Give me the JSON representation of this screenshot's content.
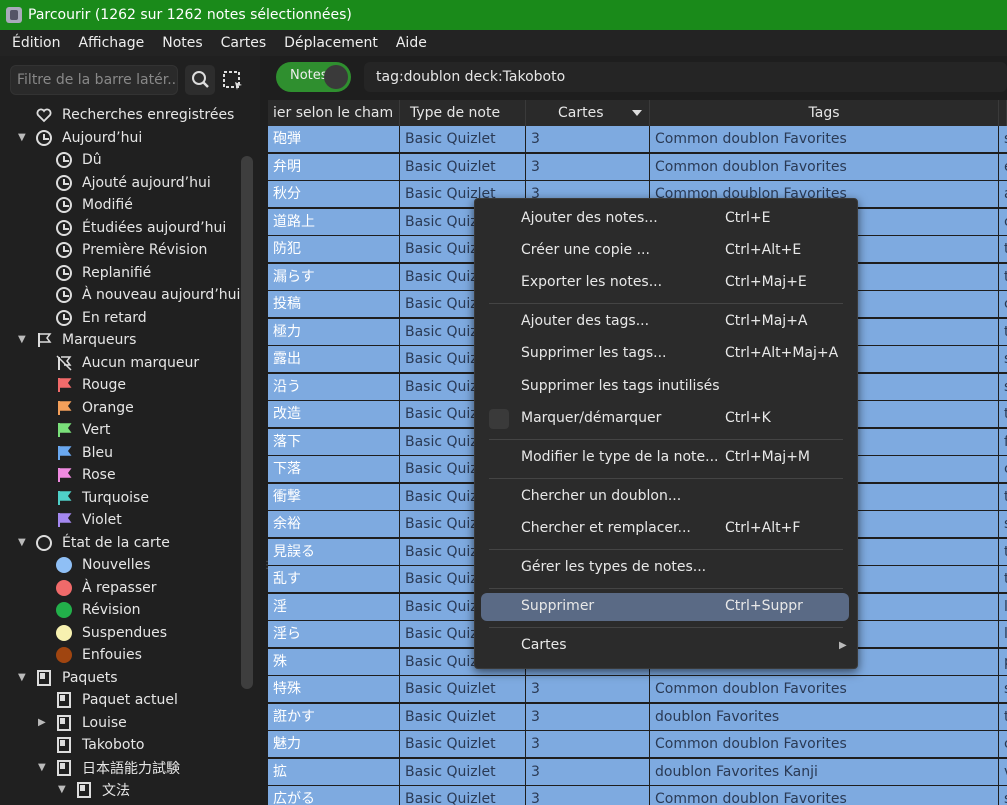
{
  "window": {
    "title": "Parcourir (1262 sur 1262 notes sélectionnées)"
  },
  "menubar": [
    "Édition",
    "Affichage",
    "Notes",
    "Cartes",
    "Déplacement",
    "Aide"
  ],
  "sidebar": {
    "filter_placeholder": "Filtre de la barre latér...",
    "tree": [
      {
        "label": "Recherches enregistrées",
        "icon": "heart-icon"
      },
      {
        "label": "Aujourd’hui",
        "icon": "clock-icon"
      },
      {
        "label": "Dû",
        "icon": "clock-icon"
      },
      {
        "label": "Ajouté aujourd’hui",
        "icon": "clock-icon"
      },
      {
        "label": "Modifié",
        "icon": "clock-icon"
      },
      {
        "label": "Étudiées aujourd’hui",
        "icon": "clock-icon"
      },
      {
        "label": "Première Révision",
        "icon": "clock-icon"
      },
      {
        "label": "Replanifié",
        "icon": "clock-icon"
      },
      {
        "label": "À nouveau aujourd’hui",
        "icon": "clock-icon"
      },
      {
        "label": "En retard",
        "icon": "clock-icon"
      },
      {
        "label": "Marqueurs",
        "icon": "flag-icon"
      },
      {
        "label": "Aucun marqueur",
        "icon": "flag-off-icon"
      },
      {
        "label": "Rouge",
        "icon": "flag-icon",
        "color": "#f26b6b"
      },
      {
        "label": "Orange",
        "icon": "flag-icon",
        "color": "#f5a05a"
      },
      {
        "label": "Vert",
        "icon": "flag-icon",
        "color": "#7ae07a"
      },
      {
        "label": "Bleu",
        "icon": "flag-icon",
        "color": "#6aa8f0"
      },
      {
        "label": "Rose",
        "icon": "flag-icon",
        "color": "#f08ae0"
      },
      {
        "label": "Turquoise",
        "icon": "flag-icon",
        "color": "#4fd0c8"
      },
      {
        "label": "Violet",
        "icon": "flag-icon",
        "color": "#a488f0"
      },
      {
        "label": "État de la carte",
        "icon": "circle-icon"
      },
      {
        "label": "Nouvelles",
        "icon": "dot-icon",
        "color": "#8fbff5"
      },
      {
        "label": "À repasser",
        "icon": "dot-icon",
        "color": "#f06a6a"
      },
      {
        "label": "Révision",
        "icon": "dot-icon",
        "color": "#22b04a"
      },
      {
        "label": "Suspendues",
        "icon": "dot-icon",
        "color": "#f7f1b0"
      },
      {
        "label": "Enfouies",
        "icon": "dot-icon",
        "color": "#a04510"
      },
      {
        "label": "Paquets",
        "icon": "deck-icon"
      },
      {
        "label": "Paquet actuel",
        "icon": "deck-icon"
      },
      {
        "label": "Louise",
        "icon": "deck-icon"
      },
      {
        "label": "Takoboto",
        "icon": "deck-icon"
      },
      {
        "label": "日本語能力試験",
        "icon": "deck-icon"
      },
      {
        "label": "文法",
        "icon": "deck-icon"
      }
    ]
  },
  "toolbar": {
    "toggle_label": "Notes",
    "search_value": "tag:doublon deck:Takoboto"
  },
  "table": {
    "columns": [
      "ier selon le cham",
      "Type de note",
      "Cartes",
      "Tags"
    ],
    "rows": [
      {
        "word": "砲弾",
        "type": "Basic Quizlet",
        "cards": "3",
        "tags": "Common doublon Favorites",
        "extra": "s"
      },
      {
        "word": "弁明",
        "type": "Basic Quizlet",
        "cards": "3",
        "tags": "Common doublon Favorites",
        "extra": "e"
      },
      {
        "word": "秋分",
        "type": "Basic Quizlet",
        "cards": "3",
        "tags": "Common doublon Favorites",
        "extra": "a"
      },
      {
        "word": "道路上",
        "type": "Basic Quizlet",
        "cards": "",
        "tags": "",
        "extra": "c"
      },
      {
        "word": "防犯",
        "type": "Basic Quizlet",
        "cards": "",
        "tags": "",
        "extra": "t"
      },
      {
        "word": "漏らす",
        "type": "Basic Quizlet",
        "cards": "",
        "tags": "",
        "extra": "t"
      },
      {
        "word": "投稿",
        "type": "Basic Quizlet",
        "cards": "",
        "tags": "",
        "extra": "c"
      },
      {
        "word": "極力",
        "type": "Basic Quizlet",
        "cards": "",
        "tags": "",
        "extra": "t"
      },
      {
        "word": "露出",
        "type": "Basic Quizlet",
        "cards": "",
        "tags": "",
        "extra": "s"
      },
      {
        "word": "沿う",
        "type": "Basic Quizlet",
        "cards": "",
        "tags": "",
        "extra": "s"
      },
      {
        "word": "改造",
        "type": "Basic Quizlet",
        "cards": "",
        "tags": "",
        "extra": "t"
      },
      {
        "word": "落下",
        "type": "Basic Quizlet",
        "cards": "",
        "tags": "",
        "extra": "f"
      },
      {
        "word": "下落",
        "type": "Basic Quizlet",
        "cards": "",
        "tags": "",
        "extra": "c"
      },
      {
        "word": "衝撃",
        "type": "Basic Quizlet",
        "cards": "",
        "tags": "",
        "extra": "t"
      },
      {
        "word": "余裕",
        "type": "Basic Quizlet",
        "cards": "",
        "tags": "",
        "extra": "s"
      },
      {
        "word": "見誤る",
        "type": "Basic Quizlet",
        "cards": "",
        "tags": "",
        "extra": "t"
      },
      {
        "word": "乱す",
        "type": "Basic Quizlet",
        "cards": "",
        "tags": "",
        "extra": "t"
      },
      {
        "word": "淫",
        "type": "Basic Quizlet",
        "cards": "",
        "tags": "",
        "extra": "l"
      },
      {
        "word": "淫ら",
        "type": "Basic Quizlet",
        "cards": "",
        "tags": "",
        "extra": "l"
      },
      {
        "word": "殊",
        "type": "Basic Quizlet",
        "cards": "",
        "tags": "",
        "extra": "p"
      },
      {
        "word": "特殊",
        "type": "Basic Quizlet",
        "cards": "3",
        "tags": "Common doublon Favorites",
        "extra": "s"
      },
      {
        "word": "誑かす",
        "type": "Basic Quizlet",
        "cards": "3",
        "tags": "doublon Favorites",
        "extra": "t"
      },
      {
        "word": "魅力",
        "type": "Basic Quizlet",
        "cards": "3",
        "tags": "Common doublon Favorites",
        "extra": "c"
      },
      {
        "word": "拡",
        "type": "Basic Quizlet",
        "cards": "3",
        "tags": "doublon Favorites Kanji",
        "extra": "v"
      },
      {
        "word": "広がる",
        "type": "Basic Quizlet",
        "cards": "3",
        "tags": "Common doublon Favorites",
        "extra": "s"
      }
    ]
  },
  "context_menu": {
    "items": [
      {
        "label": "Ajouter des notes...",
        "shortcut": "Ctrl+E"
      },
      {
        "label": "Créer une copie ...",
        "shortcut": "Ctrl+Alt+E"
      },
      {
        "label": "Exporter les notes...",
        "shortcut": "Ctrl+Maj+E"
      },
      {
        "label": "Ajouter des tags...",
        "shortcut": "Ctrl+Maj+A"
      },
      {
        "label": "Supprimer les tags...",
        "shortcut": "Ctrl+Alt+Maj+A"
      },
      {
        "label": "Supprimer les tags inutilisés",
        "shortcut": ""
      },
      {
        "label": "Marquer/démarquer",
        "shortcut": "Ctrl+K"
      },
      {
        "label": "Modifier le type de la note...",
        "shortcut": "Ctrl+Maj+M"
      },
      {
        "label": "Chercher un doublon...",
        "shortcut": ""
      },
      {
        "label": "Chercher et remplacer...",
        "shortcut": "Ctrl+Alt+F"
      },
      {
        "label": "Gérer les types de notes...",
        "shortcut": ""
      },
      {
        "label": "Supprimer",
        "shortcut": "Ctrl+Suppr"
      },
      {
        "label": "Cartes",
        "shortcut": ""
      }
    ]
  },
  "colors": {
    "titlebar": "#1a8a1a",
    "row_selected": "#7eaae0",
    "menu_highlight": "#5a6a85",
    "toggle": "#2f8f2f"
  }
}
